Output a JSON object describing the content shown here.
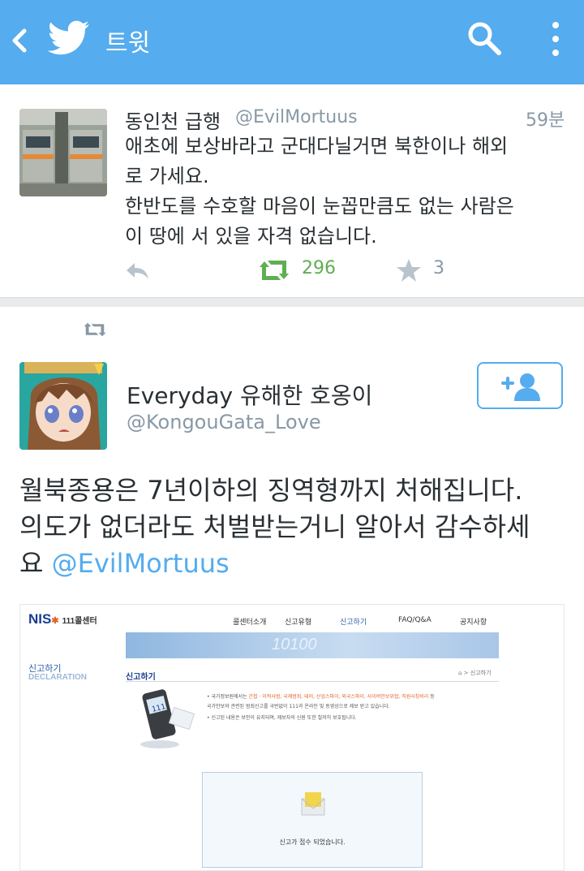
{
  "header": {
    "title": "트윗",
    "background": "#55acee",
    "icons": [
      "back-icon",
      "twitter-bird-icon",
      "search-icon",
      "overflow-menu-icon"
    ]
  },
  "tweet1": {
    "display_name": "동인천 급행",
    "handle": "@EvilMortuus",
    "time": "59분",
    "text_lines": [
      "애초에 보상바라고 군대다닐거면 북한이나 해외",
      "로 가세요.",
      "한반도를 수호할 마음이 눈꼽만큼도 없는 사람은",
      "이 땅에 서 있을 자격 없습니다."
    ],
    "retweet_count": "296",
    "favorite_count": "3",
    "retweet_color": "#5fae52"
  },
  "tweet2": {
    "display_name": "Everyday 유해한 호옹이",
    "handle": "@KongouGata_Love",
    "text_lines": [
      "월북종용은 7년이하의 징역형까지 처해집니다.",
      "의도가 없더라도 처벌받는거니 알아서 감수하세",
      "요 "
    ],
    "mention": "@EvilMortuus"
  },
  "embedded_image": {
    "logo": "NIS",
    "logo_sub": "111콜센터",
    "nav": [
      "콜센터소개",
      "신고유형",
      "신고하기",
      "FAQ/Q&A",
      "공지사항"
    ],
    "banner_text": "10100",
    "side_title": "신고하기",
    "side_subtitle": "DECLARATION",
    "section_title": "신고하기",
    "breadcrumb": "⌂ > 신고하기",
    "info_line1_pre": "• 국가정보원에서는 ",
    "info_line1_red": "간첩 · 이적사범, 국제범죄, 테러, 산업스파이, 외국스파이, 사이버안보위협, 직원사칭비리",
    "info_line1_post": " 등",
    "info_line2": "국가안보와 관련된 범죄신고를 국번없이 111과 온라인 및 동영상으로 제보 받고 있습니다.",
    "info_line3_red": "• 신고된 내용은 보안이 유지되며, 제보자의 신원 또한 철저히 보호됩니다.",
    "box_message": "신고가 접수 되었습니다."
  }
}
